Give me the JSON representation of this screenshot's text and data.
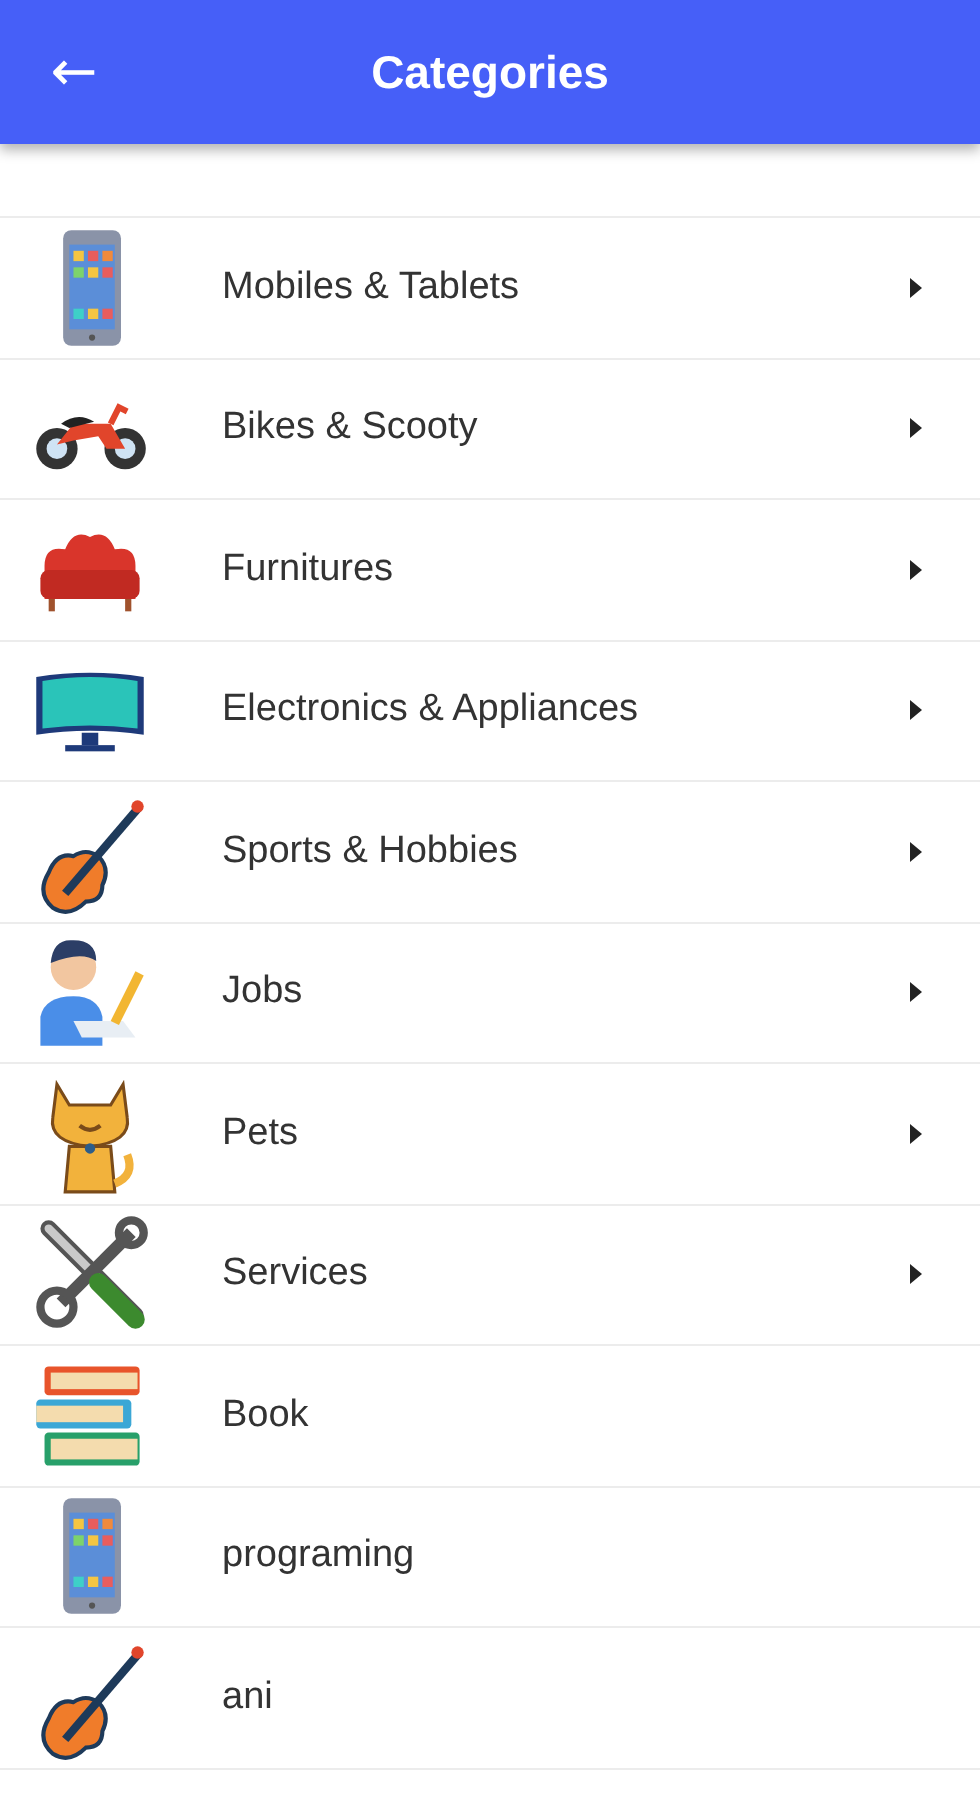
{
  "app_bar": {
    "title": "Categories",
    "back_icon": "←"
  },
  "categories": [
    {
      "label": "Mobiles & Tablets",
      "kind": "phone",
      "has_arrow": true
    },
    {
      "label": "Bikes & Scooty",
      "kind": "motorbike",
      "has_arrow": true
    },
    {
      "label": "Furnitures",
      "kind": "sofa",
      "has_arrow": true
    },
    {
      "label": "Electronics & Appliances",
      "kind": "monitor",
      "has_arrow": true
    },
    {
      "label": "Sports & Hobbies",
      "kind": "violin",
      "has_arrow": true
    },
    {
      "label": "Jobs",
      "kind": "worker",
      "has_arrow": true
    },
    {
      "label": "Pets",
      "kind": "cat",
      "has_arrow": true
    },
    {
      "label": "Services",
      "kind": "tools",
      "has_arrow": true
    },
    {
      "label": "Book",
      "kind": "books",
      "has_arrow": false
    },
    {
      "label": "programing",
      "kind": "phone",
      "has_arrow": false
    },
    {
      "label": "ani",
      "kind": "violin",
      "has_arrow": false
    }
  ]
}
